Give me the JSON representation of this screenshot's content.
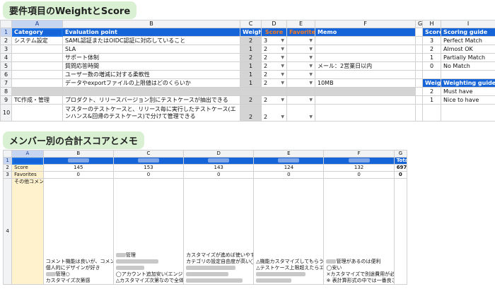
{
  "section1": {
    "title": "要件項目のWeightとScore"
  },
  "section2": {
    "title": "メンバー別の合計スコアとメモ"
  },
  "sheet1": {
    "col_letters": [
      "A",
      "B",
      "C",
      "D",
      "E",
      "F",
      "G",
      "H",
      "I"
    ],
    "row_numbers": [
      "1",
      "2",
      "3",
      "4",
      "5",
      "6",
      "7",
      "8",
      "9",
      "10"
    ],
    "headers": {
      "category": "Category",
      "evaluation": "Evaluation point",
      "weight": "Weight",
      "score": "Score",
      "favorites": "Favorites",
      "memo": "Memo"
    },
    "rows": [
      {
        "category": "システム設定",
        "point": "SAML認証またはOIDC認証に対応していること",
        "weight": "2",
        "score": "3",
        "memo": ""
      },
      {
        "category": "",
        "point": "SLA",
        "weight": "1",
        "score": "2",
        "memo": ""
      },
      {
        "category": "",
        "point": "サポート体制",
        "weight": "2",
        "score": "2",
        "memo": ""
      },
      {
        "category": "",
        "point": "質問応答時間",
        "weight": "1",
        "score": "2",
        "memo": "メール：2営業日以内"
      },
      {
        "category": "",
        "point": "ユーザー数の増減に対する柔軟性",
        "weight": "1",
        "score": "2",
        "memo": ""
      },
      {
        "category": "",
        "point": "データやexportファイルの上限値はどのくらいか",
        "weight": "1",
        "score": "2",
        "memo": "10MB"
      },
      {
        "category": "",
        "point": "",
        "weight": "",
        "score": "",
        "memo": ""
      },
      {
        "category": "TC作成・管理",
        "point": "プロダクト、リリースバージョン別にテストケースが抽出できる",
        "weight": "2",
        "score": "2",
        "memo": ""
      },
      {
        "category": "",
        "point": "マスターのテストケースと、リリース毎に実行したテストケース(エンハンス&回帰のテストケース)で分けて管理できる",
        "weight": "2",
        "score": "2",
        "memo": ""
      }
    ],
    "scoring_guide": {
      "header_score": "Score",
      "header_guide": "Scoring guide",
      "items": [
        {
          "score": "3",
          "label": "Perfect Match"
        },
        {
          "score": "2",
          "label": "Almost OK"
        },
        {
          "score": "1",
          "label": "Partially Match"
        },
        {
          "score": "0",
          "label": "No Match"
        }
      ]
    },
    "weighting_guide": {
      "header_weight": "Weight",
      "header_guide": "Weighting guide",
      "items": [
        {
          "weight": "2",
          "label": "Must have"
        },
        {
          "weight": "1",
          "label": "Nice to have"
        }
      ]
    }
  },
  "sheet2": {
    "col_letters": [
      "A",
      "B",
      "C",
      "D",
      "E",
      "F",
      "G"
    ],
    "row_numbers": [
      "1",
      "2",
      "3",
      "4"
    ],
    "total_label": "Total",
    "score_label": "Score",
    "favorites_label": "Favorites",
    "other_comment_label": "その他コメント",
    "scores": [
      "145",
      "153",
      "143",
      "124",
      "132",
      "697"
    ],
    "favorites": [
      "0",
      "0",
      "0",
      "0",
      "0",
      "0"
    ],
    "comments": {
      "b": [
        "コメント機能は良いが、コメントのカラムを別途作成しておく事に追記していく形になる △",
        "個人的にデザインが好き",
        "管理○",
        "カスタマイズ次第感"
      ],
      "c": [
        "管理",
        "",
        "◯アカウント追加安い(エンジニア陣との共有がしやすい)",
        "△カスタマイズ次第なので全体的にどうなるかが未知数"
      ],
      "d": [
        "カスタマイズが進めば使いやすくはなりそうだけどそれまでにお金がとてもかかりそう△",
        "カテゴリの設定自由度が高い◯"
      ],
      "e": [
        "△機能カスタマイズしてもらうの高そう",
        "△テストケース上限超えたらエクスポート"
      ],
      "f": [
        "管理があるのは便利",
        "◯安い",
        "×カスタマイズで別途費用が必要(人月工数だが、相談する余地はありそう)",
        "※ 表計算形式の中では一番良さそうではあるが ×"
      ]
    }
  }
}
